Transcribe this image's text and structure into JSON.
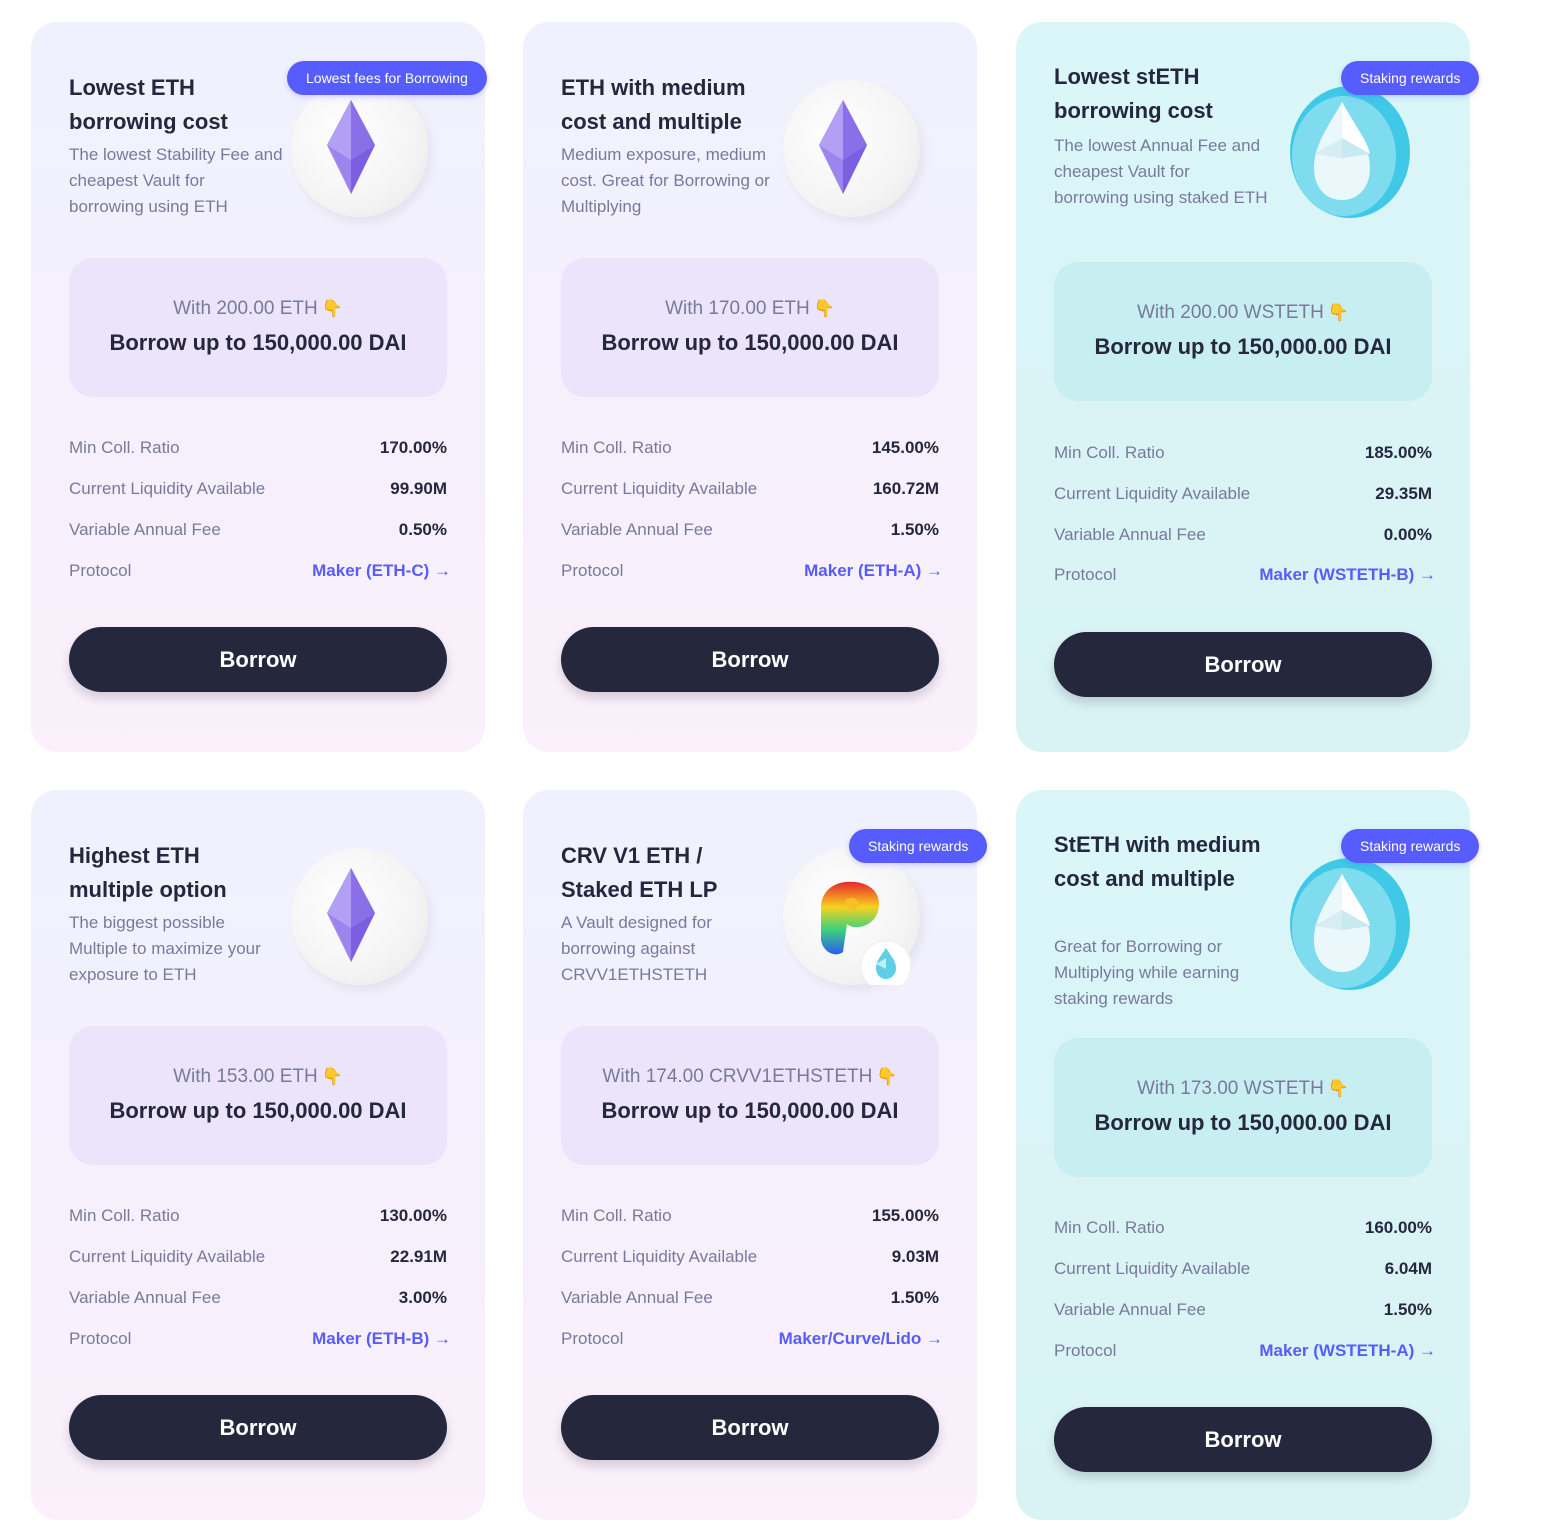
{
  "cards": [
    {
      "badge": "Lowest fees for Borrowing",
      "title": "Lowest ETH borrowing cost",
      "description": "The lowest Stability Fee and cheapest Vault for borrowing using ETH",
      "with": "With 200.00 ETH",
      "borrow": "Borrow up to 150,000.00 DAI",
      "min_coll_label": "Min Coll. Ratio",
      "min_coll": "170.00%",
      "liquidity_label": "Current Liquidity Available",
      "liquidity": "99.90M",
      "fee_label": "Variable Annual Fee",
      "fee": "0.50%",
      "protocol_label": "Protocol",
      "protocol": "Maker (ETH-C) →",
      "button": "Borrow",
      "icon": "eth-icon"
    },
    {
      "badge": "",
      "title": "ETH with medium cost and multiple",
      "description": "Medium exposure, medium cost. Great for Borrowing or Multiplying",
      "with": "With 170.00 ETH",
      "borrow": "Borrow up to 150,000.00 DAI",
      "min_coll_label": "Min Coll. Ratio",
      "min_coll": "145.00%",
      "liquidity_label": "Current Liquidity Available",
      "liquidity": "160.72M",
      "fee_label": "Variable Annual Fee",
      "fee": "1.50%",
      "protocol_label": "Protocol",
      "protocol": "Maker (ETH-A) →",
      "button": "Borrow",
      "icon": "eth-icon"
    },
    {
      "badge": "Staking rewards",
      "title": "Lowest stETH borrowing cost",
      "description": "The lowest Annual Fee and cheapest Vault for borrowing using staked ETH",
      "with": "With 200.00 WSTETH",
      "borrow": "Borrow up to 150,000.00 DAI",
      "min_coll_label": "Min Coll. Ratio",
      "min_coll": "185.00%",
      "liquidity_label": "Current Liquidity Available",
      "liquidity": "29.35M",
      "fee_label": "Variable Annual Fee",
      "fee": "0.00%",
      "protocol_label": "Protocol",
      "protocol": "Maker (WSTETH-B) →",
      "button": "Borrow",
      "icon": "steth-icon"
    },
    {
      "badge": "",
      "title": "Highest ETH multiple option",
      "description": "The biggest possible Multiple to maximize your exposure to ETH",
      "with": "With 153.00 ETH",
      "borrow": "Borrow up to 150,000.00 DAI",
      "min_coll_label": "Min Coll. Ratio",
      "min_coll": "130.00%",
      "liquidity_label": "Current Liquidity Available",
      "liquidity": "22.91M",
      "fee_label": "Variable Annual Fee",
      "fee": "3.00%",
      "protocol_label": "Protocol",
      "protocol": "Maker (ETH-B) →",
      "button": "Borrow",
      "icon": "eth-icon"
    },
    {
      "badge": "Staking rewards",
      "title": "CRV V1 ETH / Staked ETH LP",
      "description": "A Vault designed for borrowing against CRVV1ETHSTETH",
      "with": "With 174.00 CRVV1ETHSTETH",
      "borrow": "Borrow up to 150,000.00 DAI",
      "min_coll_label": "Min Coll. Ratio",
      "min_coll": "155.00%",
      "liquidity_label": "Current Liquidity Available",
      "liquidity": "9.03M",
      "fee_label": "Variable Annual Fee",
      "fee": "1.50%",
      "protocol_label": "Protocol",
      "protocol": "Maker/Curve/Lido →",
      "button": "Borrow",
      "icon": "curve-lp-icon"
    },
    {
      "badge": "Staking rewards",
      "title": "StETH with medium cost and multiple",
      "description": "Great for Borrowing or Multiplying while earning staking rewards",
      "with": "With 173.00 WSTETH",
      "borrow": "Borrow up to 150,000.00 DAI",
      "min_coll_label": "Min Coll. Ratio",
      "min_coll": "160.00%",
      "liquidity_label": "Current Liquidity Available",
      "liquidity": "6.04M",
      "fee_label": "Variable Annual Fee",
      "fee": "1.50%",
      "protocol_label": "Protocol",
      "protocol": "Maker (WSTETH-A) →",
      "button": "Borrow",
      "icon": "steth-icon"
    }
  ],
  "hand_glyph": "👇",
  "colors": {
    "accent": "#575cfe",
    "dark": "#25273d",
    "muted": "#787a9b"
  }
}
